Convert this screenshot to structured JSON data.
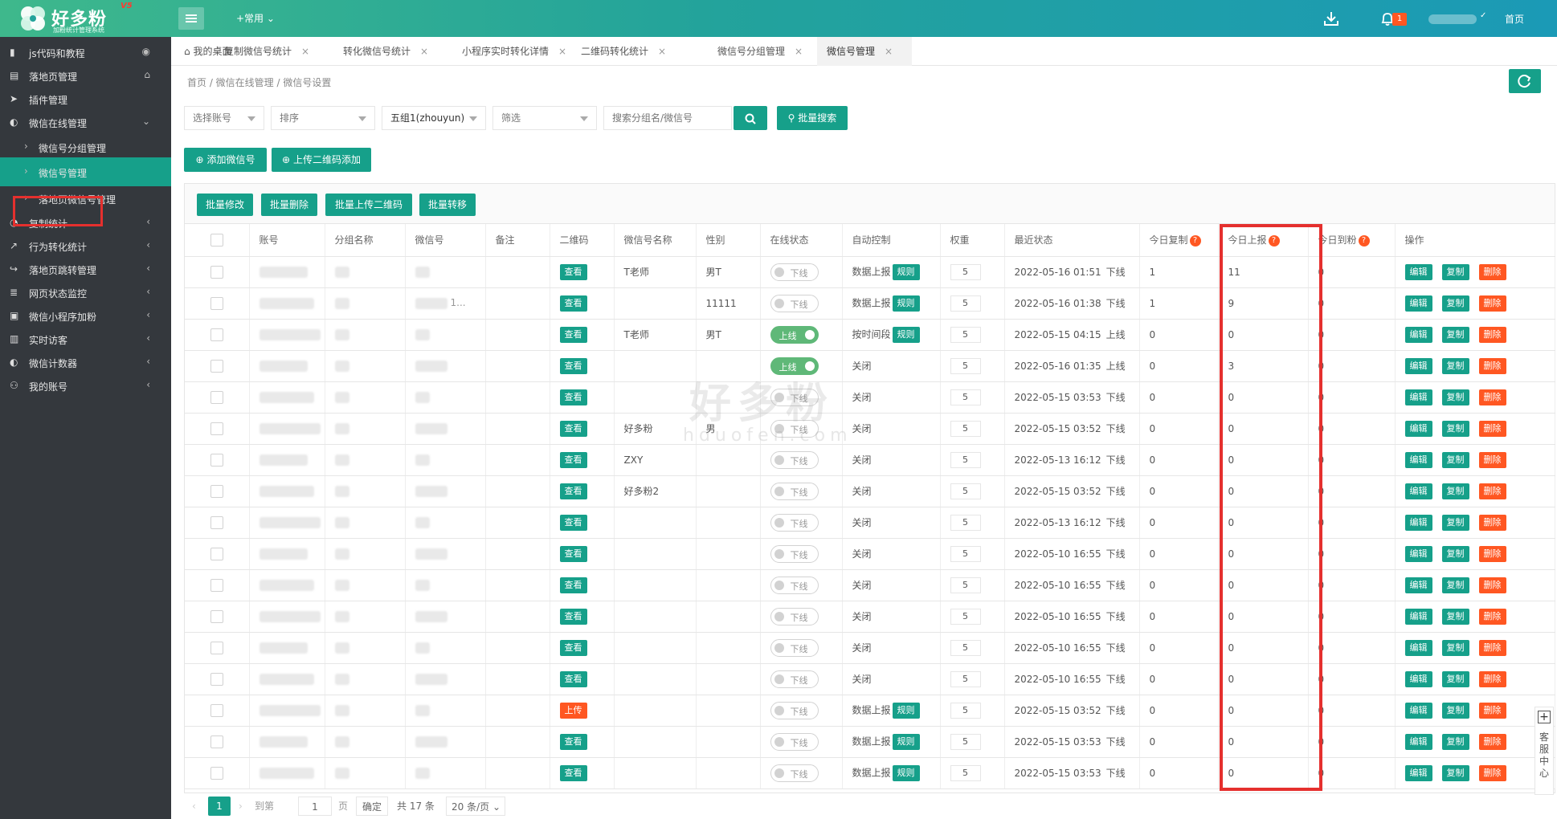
{
  "brand": {
    "name": "好多粉",
    "version": "V5",
    "subtitle": "加粉统计管理系统"
  },
  "topbar": {
    "common_label": "+常用",
    "home_label": "首页",
    "bell_count": "1"
  },
  "sidebar": {
    "items": [
      {
        "label": "js代码和教程",
        "icon": "bookmark-icon",
        "right": "eye"
      },
      {
        "label": "落地页管理",
        "icon": "document-icon",
        "right": "home"
      },
      {
        "label": "插件管理",
        "icon": "paper-plane-icon",
        "right": ""
      },
      {
        "label": "微信在线管理",
        "icon": "wechat-icon",
        "right": "down"
      },
      {
        "label": "微信号分组管理",
        "sub": true
      },
      {
        "label": "微信号管理",
        "sub": true,
        "active": true
      },
      {
        "label": "落地页微信号管理",
        "sub": true
      },
      {
        "label": "复制统计",
        "icon": "pie-icon",
        "right": "left"
      },
      {
        "label": "行为转化统计",
        "icon": "trend-icon",
        "right": "left"
      },
      {
        "label": "落地页跳转管理",
        "icon": "share-icon",
        "right": "left"
      },
      {
        "label": "网页状态监控",
        "icon": "server-icon",
        "right": "left"
      },
      {
        "label": "微信小程序加粉",
        "icon": "app-icon",
        "right": "left"
      },
      {
        "label": "实时访客",
        "icon": "bar-chart-icon",
        "right": "left"
      },
      {
        "label": "微信计数器",
        "icon": "wechat-icon",
        "right": "left"
      },
      {
        "label": "我的账号",
        "icon": "user-icon",
        "right": "left"
      }
    ]
  },
  "tabs": [
    {
      "label": "我的桌面",
      "closable": false
    },
    {
      "label": "复制微信号统计",
      "closable": true
    },
    {
      "label": "转化微信号统计",
      "closable": true
    },
    {
      "label": "小程序实时转化详情",
      "closable": true
    },
    {
      "label": "二维码转化统计",
      "closable": true
    },
    {
      "label": "微信号分组管理",
      "closable": true
    },
    {
      "label": "微信号管理",
      "closable": true,
      "active": true
    }
  ],
  "breadcrumb": "首页   /   微信在线管理   /   微信号设置",
  "filters": {
    "account": "选择账号",
    "sort": "排序",
    "group": "五组1(zhouyun)",
    "filter": "筛选",
    "search_placeholder": "搜索分组名/微信号",
    "batch_search": "批量搜索"
  },
  "actions": {
    "add": "添加微信号",
    "upload_qr": "上传二维码添加"
  },
  "batch": {
    "modify": "批量修改",
    "delete": "批量删除",
    "upload_qr": "批量上传二维码",
    "transfer": "批量转移"
  },
  "table": {
    "headers": [
      "账号",
      "分组名称",
      "微信号",
      "备注",
      "二维码",
      "微信号名称",
      "性别",
      "在线状态",
      "自动控制",
      "权重",
      "最近状态",
      "今日复制",
      "今日上报",
      "今日到粉",
      "操作"
    ],
    "row_labels": {
      "view": "查看",
      "upload": "上传",
      "rule": "规则",
      "edit": "编辑",
      "copy": "复制",
      "delete": "删除",
      "online": "上线",
      "offline": "下线"
    },
    "rows": [
      {
        "qr": "查看",
        "name": "T老师",
        "gender": "男T",
        "online": false,
        "auto": "数据上报",
        "rule": true,
        "weight": "5",
        "time": "2022-05-16 01:51",
        "state": "下线",
        "copy": "1",
        "report": "11",
        "fans": "0",
        "wx_extra": ""
      },
      {
        "qr": "查看",
        "name": "",
        "gender": "11111",
        "online": false,
        "auto": "数据上报",
        "rule": true,
        "weight": "5",
        "time": "2022-05-16 01:38",
        "state": "下线",
        "copy": "1",
        "report": "9",
        "fans": "0",
        "wx_extra": "1..."
      },
      {
        "qr": "查看",
        "name": "T老师",
        "gender": "男T",
        "online": true,
        "auto": "按时间段",
        "rule": true,
        "weight": "5",
        "time": "2022-05-15 04:15",
        "state": "上线",
        "copy": "0",
        "report": "0",
        "fans": "0",
        "wx_extra": ""
      },
      {
        "qr": "查看",
        "name": "",
        "gender": "",
        "online": true,
        "auto": "关闭",
        "rule": false,
        "weight": "5",
        "time": "2022-05-16 01:35",
        "state": "上线",
        "copy": "0",
        "report": "3",
        "fans": "0",
        "wx_extra": ""
      },
      {
        "qr": "查看",
        "name": "",
        "gender": "",
        "online": false,
        "auto": "关闭",
        "rule": false,
        "weight": "5",
        "time": "2022-05-15 03:53",
        "state": "下线",
        "copy": "0",
        "report": "0",
        "fans": "0",
        "wx_extra": ""
      },
      {
        "qr": "查看",
        "name": "好多粉",
        "gender": "男",
        "online": false,
        "auto": "关闭",
        "rule": false,
        "weight": "5",
        "time": "2022-05-15 03:52",
        "state": "下线",
        "copy": "0",
        "report": "0",
        "fans": "0",
        "wx_extra": ""
      },
      {
        "qr": "查看",
        "name": "ZXY",
        "gender": "",
        "online": false,
        "auto": "关闭",
        "rule": false,
        "weight": "5",
        "time": "2022-05-13 16:12",
        "state": "下线",
        "copy": "0",
        "report": "0",
        "fans": "0",
        "wx_extra": ""
      },
      {
        "qr": "查看",
        "name": "好多粉2",
        "gender": "",
        "online": false,
        "auto": "关闭",
        "rule": false,
        "weight": "5",
        "time": "2022-05-15 03:52",
        "state": "下线",
        "copy": "0",
        "report": "0",
        "fans": "0",
        "wx_extra": ""
      },
      {
        "qr": "查看",
        "name": "",
        "gender": "",
        "online": false,
        "auto": "关闭",
        "rule": false,
        "weight": "5",
        "time": "2022-05-13 16:12",
        "state": "下线",
        "copy": "0",
        "report": "0",
        "fans": "0",
        "wx_extra": ""
      },
      {
        "qr": "查看",
        "name": "",
        "gender": "",
        "online": false,
        "auto": "关闭",
        "rule": false,
        "weight": "5",
        "time": "2022-05-10 16:55",
        "state": "下线",
        "copy": "0",
        "report": "0",
        "fans": "0",
        "wx_extra": ""
      },
      {
        "qr": "查看",
        "name": "",
        "gender": "",
        "online": false,
        "auto": "关闭",
        "rule": false,
        "weight": "5",
        "time": "2022-05-10 16:55",
        "state": "下线",
        "copy": "0",
        "report": "0",
        "fans": "0",
        "wx_extra": ""
      },
      {
        "qr": "查看",
        "name": "",
        "gender": "",
        "online": false,
        "auto": "关闭",
        "rule": false,
        "weight": "5",
        "time": "2022-05-10 16:55",
        "state": "下线",
        "copy": "0",
        "report": "0",
        "fans": "0",
        "wx_extra": ""
      },
      {
        "qr": "查看",
        "name": "",
        "gender": "",
        "online": false,
        "auto": "关闭",
        "rule": false,
        "weight": "5",
        "time": "2022-05-10 16:55",
        "state": "下线",
        "copy": "0",
        "report": "0",
        "fans": "0",
        "wx_extra": ""
      },
      {
        "qr": "查看",
        "name": "",
        "gender": "",
        "online": false,
        "auto": "关闭",
        "rule": false,
        "weight": "5",
        "time": "2022-05-10 16:55",
        "state": "下线",
        "copy": "0",
        "report": "0",
        "fans": "0",
        "wx_extra": ""
      },
      {
        "qr": "上传",
        "name": "",
        "gender": "",
        "online": false,
        "auto": "数据上报",
        "rule": true,
        "weight": "5",
        "time": "2022-05-15 03:52",
        "state": "下线",
        "copy": "0",
        "report": "0",
        "fans": "0",
        "wx_extra": ""
      },
      {
        "qr": "查看",
        "name": "",
        "gender": "",
        "online": false,
        "auto": "数据上报",
        "rule": true,
        "weight": "5",
        "time": "2022-05-15 03:53",
        "state": "下线",
        "copy": "0",
        "report": "0",
        "fans": "0",
        "wx_extra": ""
      },
      {
        "qr": "查看",
        "name": "",
        "gender": "",
        "online": false,
        "auto": "数据上报",
        "rule": true,
        "weight": "5",
        "time": "2022-05-15 03:53",
        "state": "下线",
        "copy": "0",
        "report": "0",
        "fans": "0",
        "wx_extra": ""
      }
    ]
  },
  "pagination": {
    "current": "1",
    "goto": "到第",
    "page_input": "1",
    "page_unit": "页",
    "confirm": "确定",
    "total": "共 17 条",
    "per_page": "20 条/页"
  },
  "watermark": {
    "main": "好多粉",
    "sub": "hduofen.com"
  },
  "float_service": "客服中心",
  "colors": {
    "primary": "#16a08a",
    "danger": "#ff5722",
    "highlight": "#e5302e",
    "sidebar": "#34383d"
  }
}
